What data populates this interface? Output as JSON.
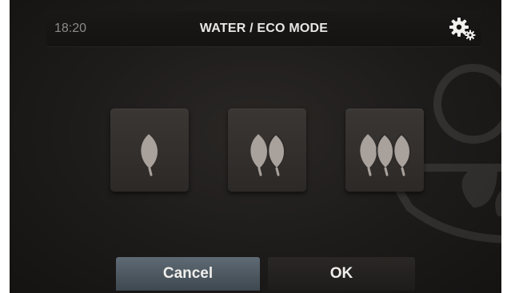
{
  "header": {
    "time": "18:20",
    "title": "WATER / ECO MODE",
    "settings_icon": "gear-icon"
  },
  "eco_levels": [
    {
      "leaf_count": 1,
      "icon": "leaf-icon"
    },
    {
      "leaf_count": 2,
      "icon": "leaf-icon"
    },
    {
      "leaf_count": 3,
      "icon": "leaf-icon"
    }
  ],
  "footer": {
    "cancel_label": "Cancel",
    "ok_label": "OK"
  },
  "colors": {
    "background": "#1d1b1a",
    "leaf": "#a9a19b",
    "cancel_button": "#4c5760",
    "title_text": "#e8e6e3"
  }
}
